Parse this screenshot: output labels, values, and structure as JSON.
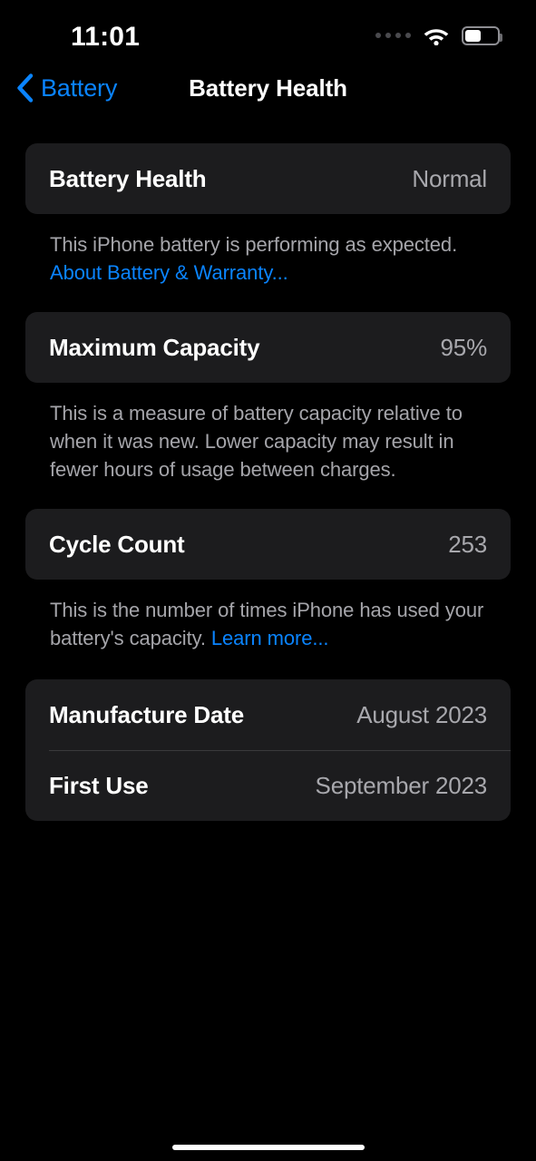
{
  "status_bar": {
    "time": "11:01",
    "signal_icon": "cellular-dots-icon",
    "wifi_icon": "wifi-icon",
    "battery_icon": "battery-icon",
    "battery_level_pct": 47
  },
  "nav": {
    "back_icon": "chevron-left-icon",
    "back_label": "Battery",
    "title": "Battery Health"
  },
  "sections": [
    {
      "rows": [
        {
          "label": "Battery Health",
          "value": "Normal"
        }
      ],
      "footer": {
        "text": "This iPhone battery is performing as expected. ",
        "link": "About Battery & Warranty..."
      }
    },
    {
      "rows": [
        {
          "label": "Maximum Capacity",
          "value": "95%"
        }
      ],
      "footer": {
        "text": "This is a measure of battery capacity relative to when it was new. Lower capacity may result in fewer hours of usage between charges.",
        "link": ""
      }
    },
    {
      "rows": [
        {
          "label": "Cycle Count",
          "value": "253"
        }
      ],
      "footer": {
        "text": "This is the number of times iPhone has used your battery's capacity. ",
        "link": "Learn more..."
      }
    },
    {
      "rows": [
        {
          "label": "Manufacture Date",
          "value": "August 2023"
        },
        {
          "label": "First Use",
          "value": "September 2023"
        }
      ],
      "footer": {
        "text": "",
        "link": ""
      }
    }
  ],
  "colors": {
    "background": "#000000",
    "card": "#1c1c1e",
    "accent_blue": "#0a84ff",
    "label": "#ffffff",
    "value": "#a8a8ad",
    "footer_text": "#a5a5aa",
    "divider": "#3a3a3c"
  },
  "home_indicator": "home-indicator"
}
